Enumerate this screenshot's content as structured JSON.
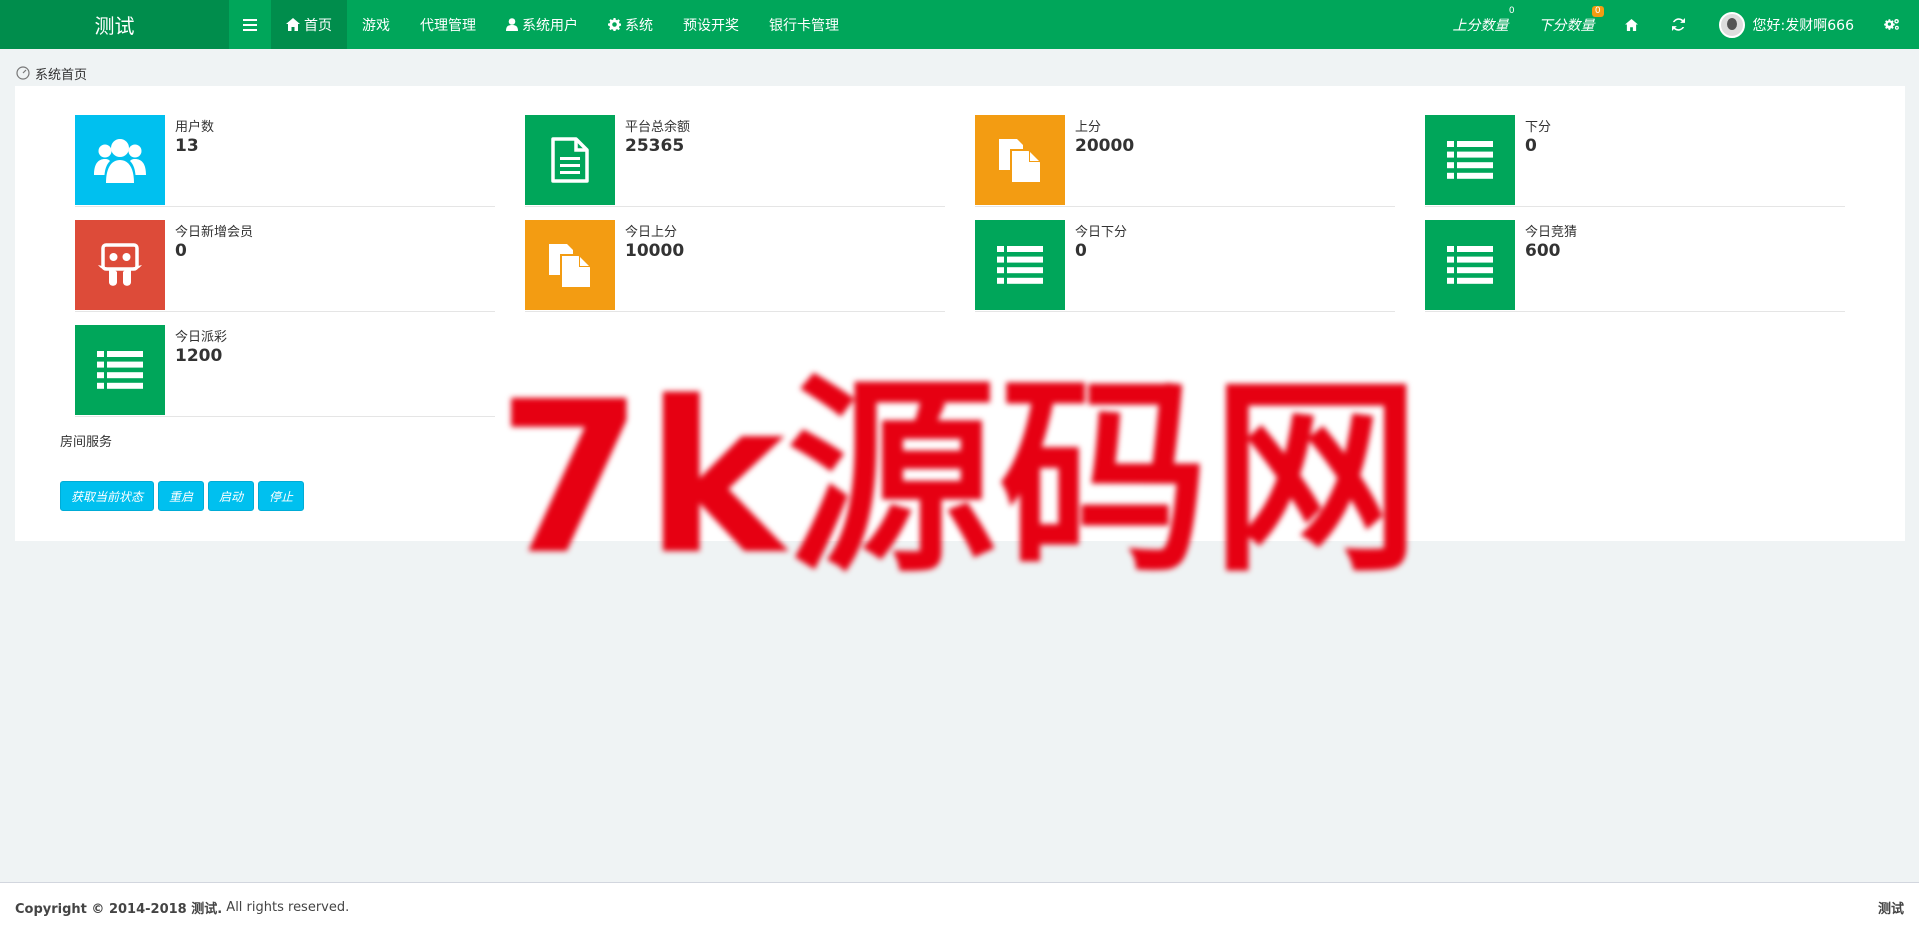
{
  "navbar": {
    "brand": "测试",
    "items": [
      {
        "label": "首页",
        "icon": "home-icon"
      },
      {
        "label": "游戏"
      },
      {
        "label": "代理管理"
      },
      {
        "label": "系统用户",
        "icon": "user-icon"
      },
      {
        "label": "系统",
        "icon": "gear-icon"
      },
      {
        "label": "预设开奖"
      },
      {
        "label": "银行卡管理"
      }
    ],
    "right": {
      "up_count_label": "上分数量",
      "up_count_badge": "0",
      "down_count_label": "下分数量",
      "down_count_badge": "0",
      "greeting": "您好:发财啊666"
    }
  },
  "breadcrumb": {
    "label": "系统首页"
  },
  "info_boxes": [
    {
      "label": "用户数",
      "value": "13",
      "icon": "users-icon",
      "color": "#00c0ef"
    },
    {
      "label": "平台总余额",
      "value": "25365",
      "icon": "file-text-icon",
      "color": "#00a65a"
    },
    {
      "label": "上分",
      "value": "20000",
      "icon": "files-icon",
      "color": "#f39c12"
    },
    {
      "label": "下分",
      "value": "0",
      "icon": "list-icon",
      "color": "#00a65a"
    },
    {
      "label": "今日新增会员",
      "value": "0",
      "icon": "slideshare-icon",
      "color": "#dd4b39"
    },
    {
      "label": "今日上分",
      "value": "10000",
      "icon": "files-icon",
      "color": "#f39c12"
    },
    {
      "label": "今日下分",
      "value": "0",
      "icon": "list-icon",
      "color": "#00a65a"
    },
    {
      "label": "今日竞猜",
      "value": "600",
      "icon": "list-icon",
      "color": "#00a65a"
    },
    {
      "label": "今日派彩",
      "value": "1200",
      "icon": "list-icon",
      "color": "#00a65a"
    }
  ],
  "room_service": {
    "title": "房间服务",
    "buttons": [
      "获取当前状态",
      "重启",
      "启动",
      "停止"
    ]
  },
  "footer": {
    "copyright_bold": "Copyright © 2014-2018 测试.",
    "copyright_rest": " All rights reserved.",
    "right": "测试"
  },
  "watermark": "7k源码网"
}
